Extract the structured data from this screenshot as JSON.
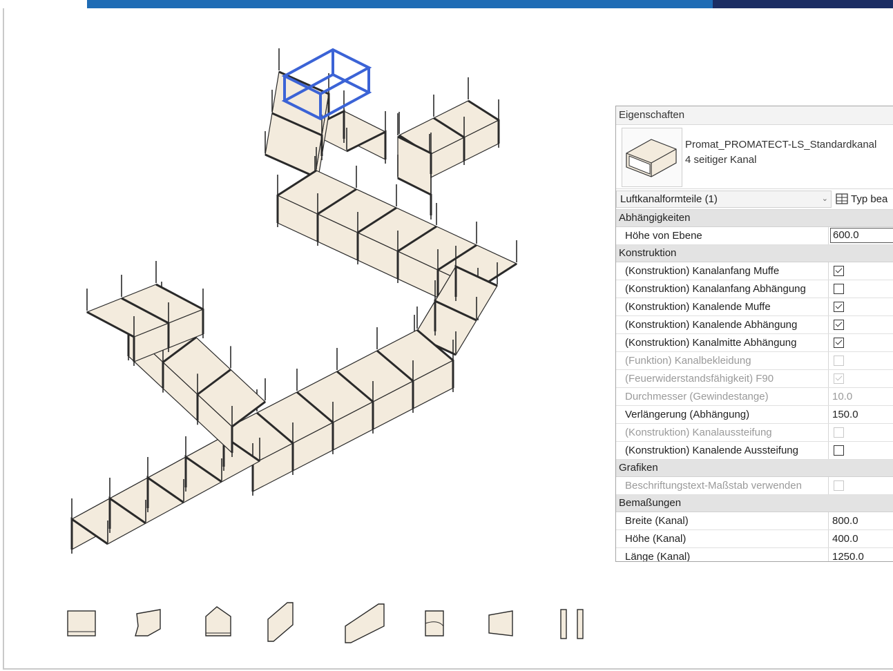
{
  "colors": {
    "duct_fill": "#f3ebdd",
    "duct_line": "#2a2a2a",
    "selection": "#3b63d6",
    "brand_blue": "#1f6cb5",
    "brand_navy": "#1b2d63"
  },
  "properties": {
    "title": "Eigenschaften",
    "type_name": "Promat_PROMATECT-LS_Standardkanal",
    "type_subname": "4 seitiger Kanal",
    "category_selector": "Luftkanalformteile (1)",
    "type_button_label": "Typ bea",
    "groups": [
      {
        "name": "Abhängigkeiten",
        "rows": [
          {
            "label": "Höhe von Ebene",
            "value": "600.0",
            "kind": "edit"
          }
        ]
      },
      {
        "name": "Konstruktion",
        "rows": [
          {
            "label": "(Konstruktion) Kanalanfang Muffe",
            "checked": true,
            "kind": "check"
          },
          {
            "label": "(Konstruktion) Kanalanfang Abhängung",
            "checked": false,
            "kind": "check"
          },
          {
            "label": "(Konstruktion) Kanalende Muffe",
            "checked": true,
            "kind": "check"
          },
          {
            "label": "(Konstruktion) Kanalende Abhängung",
            "checked": true,
            "kind": "check"
          },
          {
            "label": "(Konstruktion) Kanalmitte Abhängung",
            "checked": true,
            "kind": "check"
          },
          {
            "label": "(Funktion) Kanalbekleidung",
            "checked": false,
            "kind": "check",
            "disabled": true
          },
          {
            "label": "(Feuerwiderstandsfähigkeit) F90",
            "checked": true,
            "kind": "check",
            "disabled": true
          },
          {
            "label": "Durchmesser (Gewindestange)",
            "value": "10.0",
            "kind": "text",
            "disabled": true
          },
          {
            "label": "Verlängerung (Abhängung)",
            "value": "150.0",
            "kind": "text"
          },
          {
            "label": "(Konstruktion) Kanalaussteifung",
            "checked": false,
            "kind": "check",
            "disabled": true
          },
          {
            "label": "(Konstruktion) Kanalende Aussteifung",
            "checked": false,
            "kind": "check"
          }
        ]
      },
      {
        "name": "Grafiken",
        "rows": [
          {
            "label": "Beschriftungstext-Maßstab verwenden",
            "checked": false,
            "kind": "check",
            "disabled": true
          }
        ]
      },
      {
        "name": "Bemaßungen",
        "rows": [
          {
            "label": "Breite (Kanal)",
            "value": "800.0",
            "kind": "text"
          },
          {
            "label": "Höhe (Kanal)",
            "value": "400.0",
            "kind": "text"
          },
          {
            "label": "Länge (Kanal)",
            "value": "1250.0",
            "kind": "text"
          }
        ]
      }
    ]
  },
  "fitting_legend": [
    "straight-duct",
    "elbow",
    "tee",
    "offset",
    "long-offset",
    "branch",
    "transition",
    "end-cap"
  ]
}
